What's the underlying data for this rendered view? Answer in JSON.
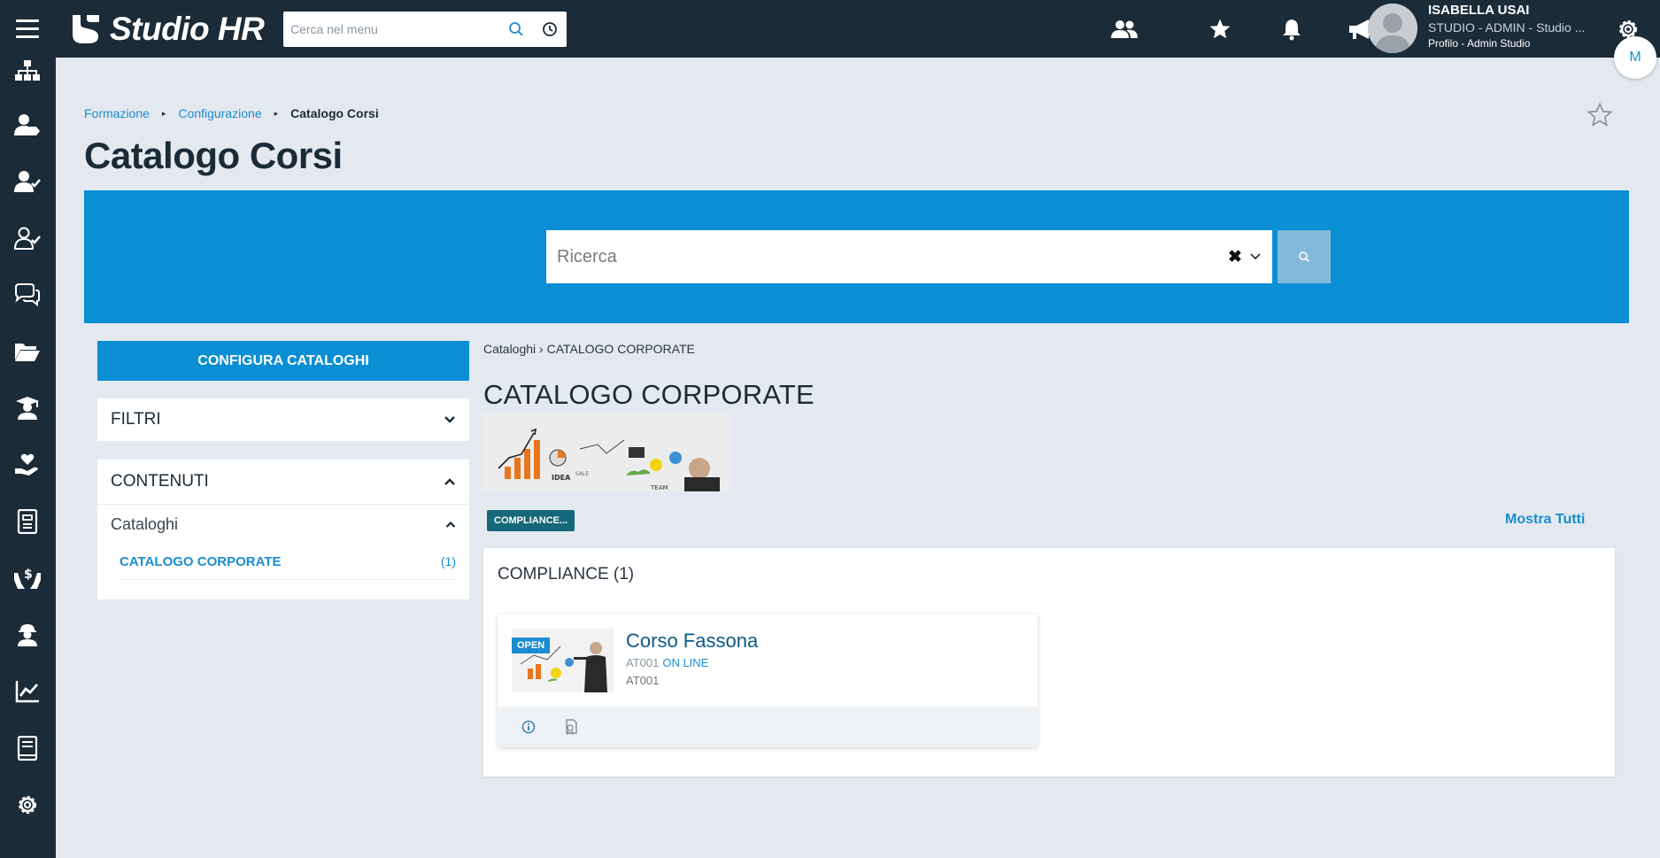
{
  "topbar": {
    "app_name": "Studio HR",
    "menu_search_placeholder": "Cerca nel menu",
    "user": {
      "name": "ISABELLA USAI",
      "role": "STUDIO - ADMIN - Studio ...",
      "profile": "Profilo - Admin Studio"
    },
    "bubble_letter": "M"
  },
  "breadcrumb": {
    "items": [
      "Formazione",
      "Configurazione"
    ],
    "current": "Catalogo Corsi"
  },
  "page_title": "Catalogo Corsi",
  "search": {
    "placeholder": "Ricerca",
    "clear_symbol": "✖"
  },
  "left_panel": {
    "config_button": "CONFIGURA CATALOGHI",
    "filters_title": "FILTRI",
    "contents_title": "CONTENUTI",
    "catalogs_label": "Cataloghi",
    "catalog_items": [
      {
        "label": "CATALOGO CORPORATE",
        "count": "(1)"
      }
    ]
  },
  "content": {
    "sub_breadcrumb": {
      "root": "Cataloghi",
      "separator": "›",
      "current": "CATALOGO CORPORATE"
    },
    "catalog_title": "CATALOGO CORPORATE",
    "tag_label": "COMPLIANCE...",
    "show_all": "Mostra Tutti",
    "section_title": "COMPLIANCE (1)",
    "course": {
      "badge": "OPEN",
      "name": "Corso Fassona",
      "code": "AT001",
      "mode": "ON LINE",
      "code_line": "AT001"
    }
  },
  "colors": {
    "topbar": "#1b2b38",
    "accent": "#0a8ed4",
    "background": "#e4e9f0",
    "tag": "#15687b"
  },
  "icons": {
    "topbar": [
      "hamburger-icon",
      "search-icon",
      "history-icon",
      "users-icon",
      "star-icon",
      "bell-icon",
      "megaphone-icon",
      "gear-icon"
    ],
    "sidebar": [
      "org-chart-icon",
      "user-tag-icon",
      "user-check-icon",
      "user-check-outline-icon",
      "chat-icon",
      "folder-open-icon",
      "graduate-icon",
      "hand-heart-icon",
      "document-icon",
      "hands-money-icon",
      "worker-icon",
      "chart-line-icon",
      "book-icon",
      "settings-icon"
    ],
    "card": [
      "info-icon",
      "certificate-icon"
    ]
  }
}
